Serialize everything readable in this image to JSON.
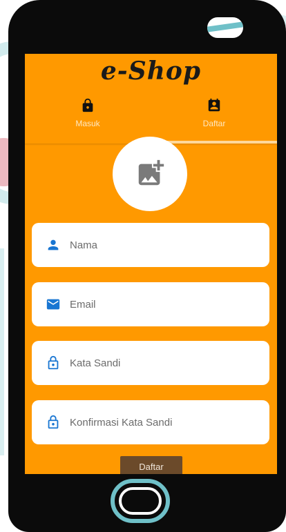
{
  "app": {
    "logo_text": "e-Shop"
  },
  "tabs": [
    {
      "label": "Masuk",
      "icon": "lock-icon",
      "selected": false
    },
    {
      "label": "Daftar",
      "icon": "contact-calendar-icon",
      "selected": true
    }
  ],
  "form": {
    "name_placeholder": "Nama",
    "email_placeholder": "Email",
    "password_placeholder": "Kata Sandi",
    "confirm_password_placeholder": "Konfirmasi Kata Sandi",
    "submit_label": "Daftar"
  },
  "colors": {
    "primary": "#ff9900",
    "tab_indicator": "#ffd89a",
    "icon_blue": "#1976d2",
    "button_brown": "#6b4a2a"
  }
}
